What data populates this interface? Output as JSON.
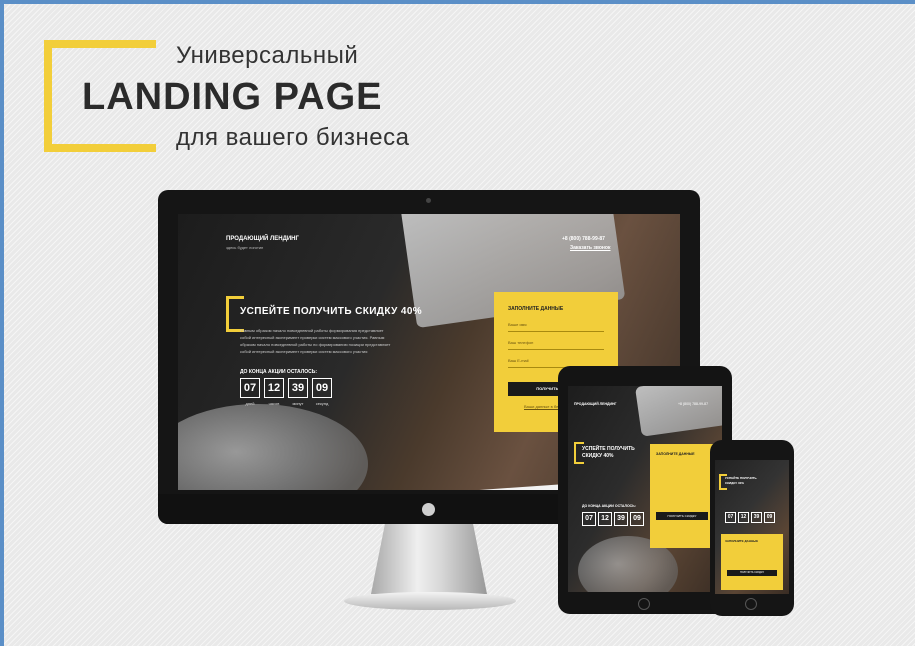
{
  "headline": {
    "line1": "Универсальный",
    "line2": "LANDING PAGE",
    "line3": "для вашего бизнеса"
  },
  "brand_color": "#f2ce3a",
  "landing": {
    "site_title": "ПРОДАЮЩИЙ ЛЕНДИНГ",
    "site_subtitle": "здесь будет логотип",
    "phone": "+8 (800) 788-99-87",
    "callback": "Заказать звонок",
    "offer": "УСПЕЙТЕ ПОЛУЧИТЬ СКИДКУ 40%",
    "body_text_1": "Равным образом начало повседневной работы формирования представляет",
    "body_text_2": "собой интересный эксперимент проверки систем массового участия. Равным",
    "body_text_3": "образом начало повседневной работы по формированию позиции представляет",
    "body_text_4": "собой интересный эксперимент проверки систем массового участия",
    "countdown_title": "ДО КОНЦА АКЦИИ ОСТАЛОСЬ:",
    "countdown": [
      {
        "value": "07",
        "label": "дней"
      },
      {
        "value": "12",
        "label": "часов"
      },
      {
        "value": "39",
        "label": "минут"
      },
      {
        "value": "09",
        "label": "секунд"
      }
    ],
    "form_title": "ЗАПОЛНИТЕ ДАННЫЕ",
    "field_name": "Ваше имя",
    "field_phone": "Ваш телефон",
    "field_email": "Ваш E-mail",
    "submit": "ПОЛУЧИТЬ СКИДКУ",
    "privacy": "Ваши данные в безопасности"
  },
  "tablet": {
    "offer_1": "УСПЕЙТЕ ПОЛУЧИТЬ",
    "offer_2": "СКИДКУ 40%",
    "form_title": "ЗАПОЛНИТЕ ДАННЫЕ",
    "submit": "ПОЛУЧИТЬ СКИДКУ",
    "countdown_title": "ДО КОНЦА АКЦИИ ОСТАЛОСЬ:"
  },
  "phone_dev": {
    "offer_1": "УСПЕЙТЕ ПОЛУЧИТЬ",
    "offer_2": "СКИДКУ 40%",
    "form_title": "ЗАПОЛНИТЕ ДАННЫЕ",
    "submit": "ПОЛУЧИТЬ СКИДКУ"
  }
}
